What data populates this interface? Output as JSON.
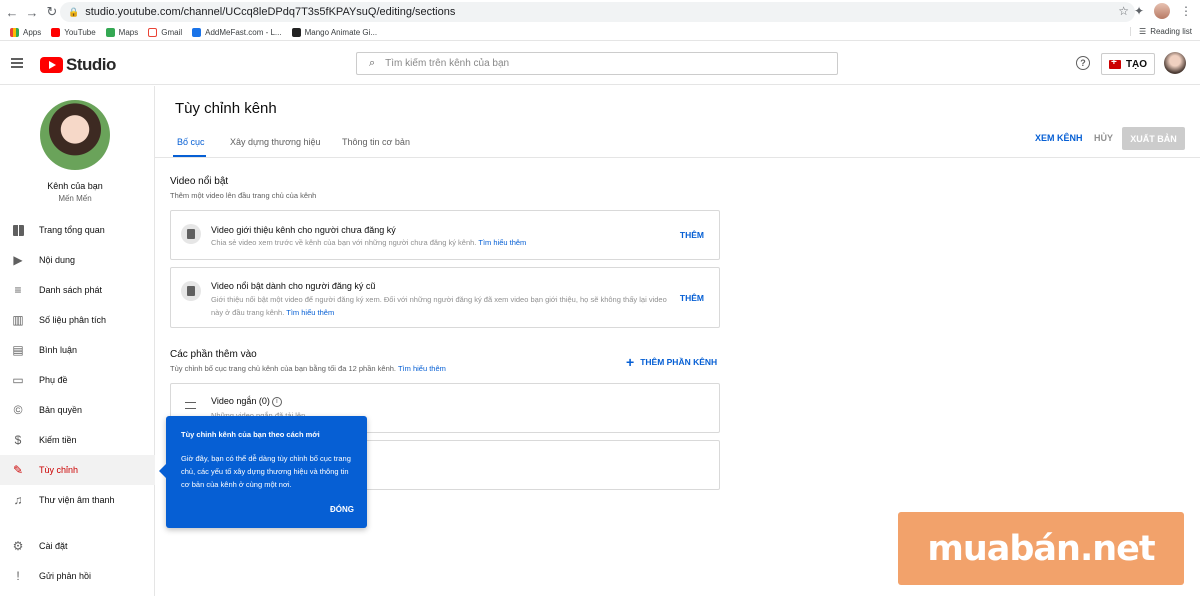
{
  "browser": {
    "url": "studio.youtube.com/channel/UCcq8leDPdq7T3s5fKPAYsuQ/editing/sections",
    "bookmarks": [
      "Apps",
      "YouTube",
      "Maps",
      "Gmail",
      "AddMeFast.com - L...",
      "Mango Animate Gi..."
    ],
    "reading_list": "Reading list"
  },
  "header": {
    "logo_text": "Studio",
    "search_placeholder": "Tìm kiếm trên kênh của bạn",
    "create_label": "TẠO"
  },
  "sidebar": {
    "channel_title": "Kênh của bạn",
    "channel_name": "Mến Mến",
    "items": [
      {
        "label": "Trang tổng quan",
        "icon": "dashboard-icon"
      },
      {
        "label": "Nội dung",
        "icon": "content-icon"
      },
      {
        "label": "Danh sách phát",
        "icon": "playlist-icon"
      },
      {
        "label": "Số liệu phân tích",
        "icon": "analytics-icon"
      },
      {
        "label": "Bình luận",
        "icon": "comments-icon"
      },
      {
        "label": "Phụ đề",
        "icon": "subtitles-icon"
      },
      {
        "label": "Bản quyền",
        "icon": "copyright-icon"
      },
      {
        "label": "Kiếm tiền",
        "icon": "monetization-icon"
      },
      {
        "label": "Tùy chỉnh",
        "icon": "customization-icon"
      },
      {
        "label": "Thư viện âm thanh",
        "icon": "audio-library-icon"
      },
      {
        "label": "Cài đặt",
        "icon": "settings-icon"
      },
      {
        "label": "Gửi phản hồi",
        "icon": "feedback-icon"
      }
    ]
  },
  "main": {
    "title": "Tùy chỉnh kênh",
    "tabs": [
      "Bố cục",
      "Xây dựng thương hiệu",
      "Thông tin cơ bản"
    ],
    "view_channel": "XEM KÊNH",
    "cancel": "HỦY",
    "publish": "XUẤT BẢN",
    "featured": {
      "title": "Video nổi bật",
      "desc": "Thêm một video lên đầu trang chủ của kênh",
      "cards": [
        {
          "title": "Video giới thiệu kênh cho người chưa đăng ký",
          "desc": "Chia sẻ video xem trước về kênh của bạn với những người chưa đăng ký kênh.",
          "link": "Tìm hiểu thêm",
          "action": "THÊM"
        },
        {
          "title": "Video nổi bật dành cho người đăng ký cũ",
          "desc": "Giới thiệu nổi bật một video để người đăng ký xem. Đối với những người đăng ký đã xem video bạn giới thiệu, họ sẽ không thấy lại video này ở đầu trang kênh.",
          "link": "Tìm hiểu thêm",
          "action": "THÊM"
        }
      ]
    },
    "sections": {
      "title": "Các phần thêm vào",
      "desc": "Tùy chỉnh bố cục trang chủ kênh của bạn bằng tối đa 12 phần kênh.",
      "link": "Tìm hiểu thêm",
      "add_label": "THÊM PHẦN KÊNH",
      "shorts_title": "Video ngắn (0)",
      "shorts_desc": "Những video ngắn đã tải lên"
    }
  },
  "tooltip": {
    "title": "Tùy chỉnh kênh của bạn theo cách mới",
    "body": "Giờ đây, bạn có thể dễ dàng tùy chỉnh bố cục trang chủ, các yếu tố xây dựng thương hiệu và thông tin cơ bản của kênh ở cùng một nơi.",
    "close": "ĐÓNG"
  },
  "watermark": "muabán.net"
}
